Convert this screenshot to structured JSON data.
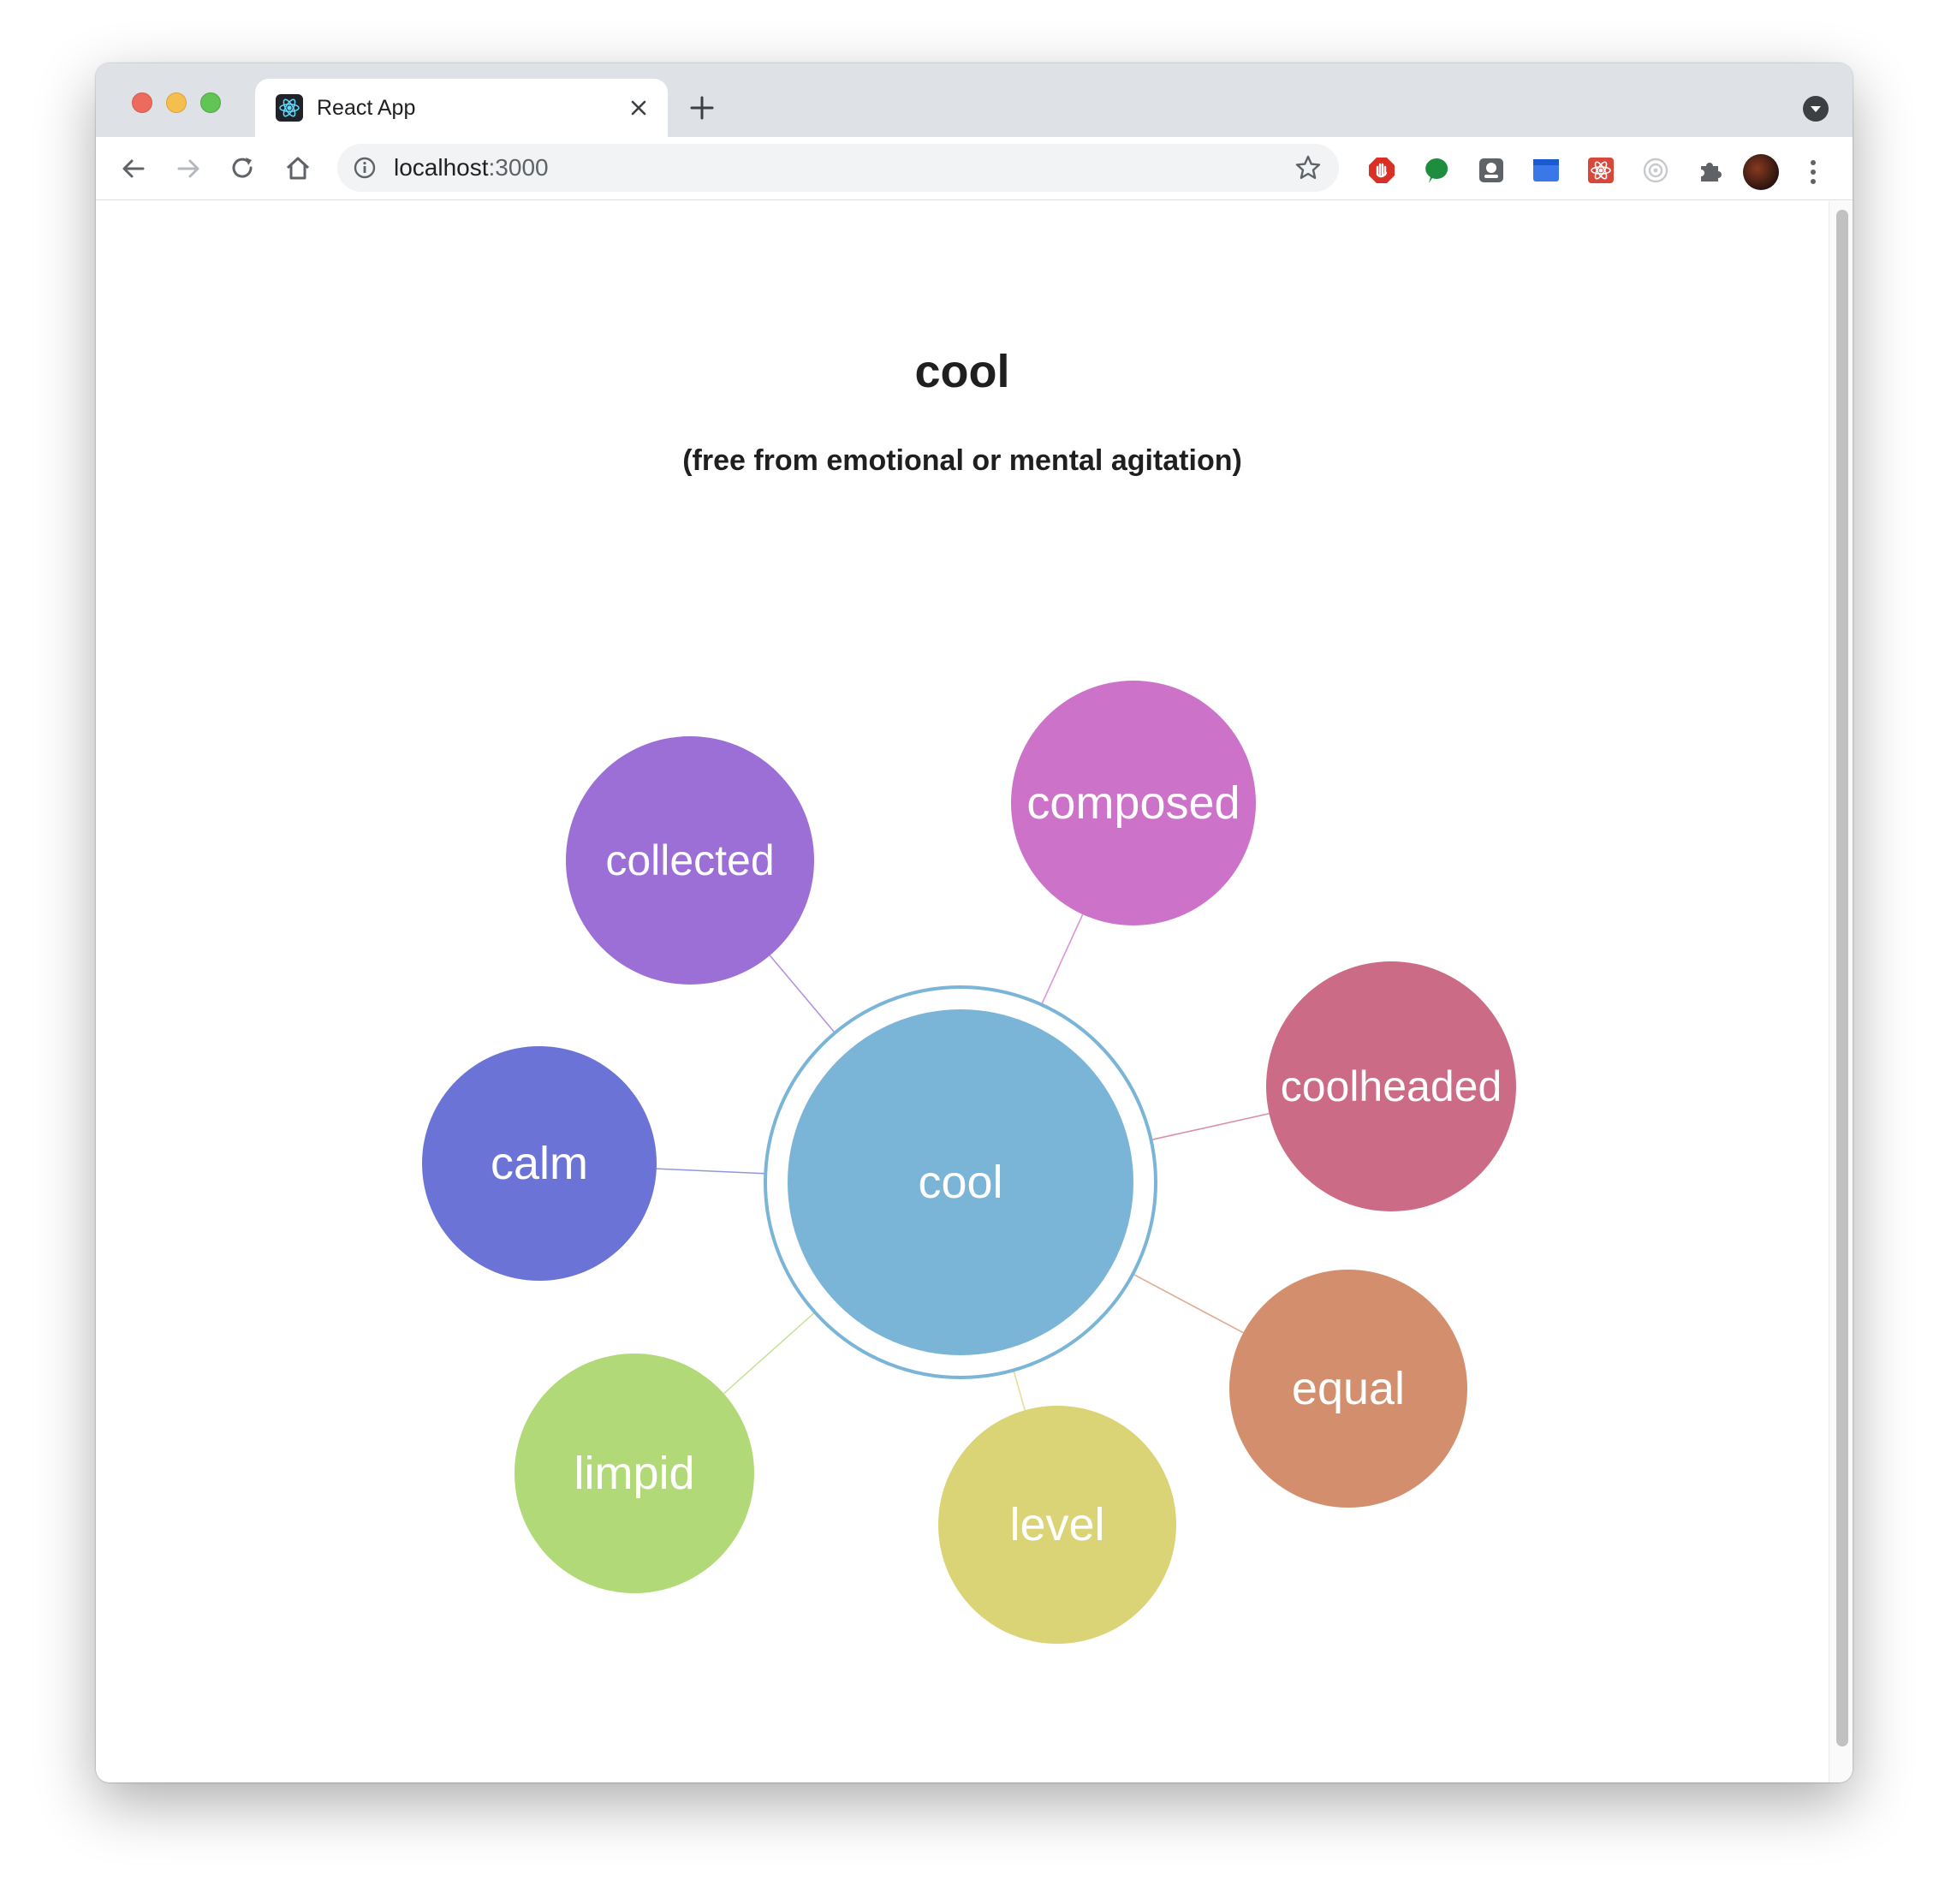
{
  "browser": {
    "tab_title": "React App",
    "url_host": "localhost",
    "url_port": ":3000",
    "icons": {
      "favicon": "react-favicon-icon",
      "tab_close": "close-icon",
      "new_tab": "plus-icon",
      "tab_menu": "chevron-down-icon",
      "back": "back-arrow-icon",
      "forward": "forward-arrow-icon",
      "reload": "reload-icon",
      "home": "home-icon",
      "site_info": "info-icon",
      "bookmark": "star-icon",
      "extensions": [
        "adblock-icon",
        "chat-bubble-icon",
        "badge-icon",
        "calendar-icon",
        "react-devtools-icon",
        "target-icon",
        "puzzle-icon"
      ],
      "profile": "avatar",
      "menu": "kebab-menu-icon"
    }
  },
  "page": {
    "title": "cool",
    "definition": "(free from emotional or mental agitation)"
  },
  "graph": {
    "center": {
      "label": "cool",
      "color": "#7ab5d8",
      "ring_color": "#7ab5d8"
    },
    "synonyms": [
      {
        "label": "collected",
        "color": "#9b6fd6"
      },
      {
        "label": "composed",
        "color": "#cd72c9"
      },
      {
        "label": "coolheaded",
        "color": "#cc6b85"
      },
      {
        "label": "equal",
        "color": "#d38f6d"
      },
      {
        "label": "level",
        "color": "#dad476"
      },
      {
        "label": "limpid",
        "color": "#b1d978"
      },
      {
        "label": "calm",
        "color": "#6b74d6"
      }
    ]
  }
}
